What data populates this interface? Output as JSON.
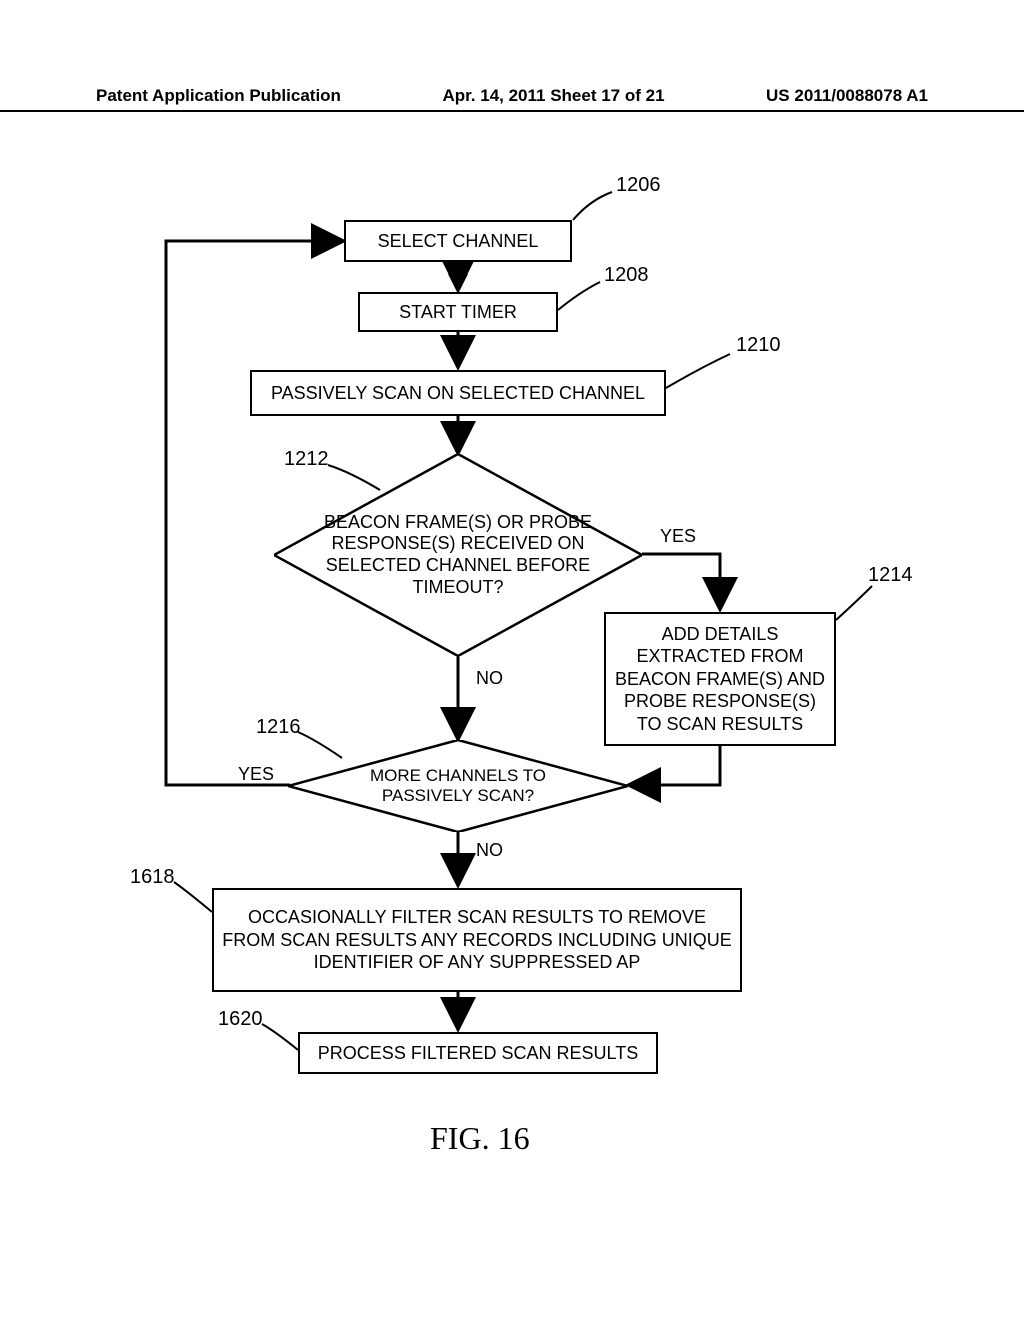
{
  "header": {
    "left": "Patent Application Publication",
    "center": "Apr. 14, 2011  Sheet 17 of 21",
    "right": "US 2011/0088078 A1"
  },
  "refs": {
    "r1206": "1206",
    "r1208": "1208",
    "r1210": "1210",
    "r1212": "1212",
    "r1214": "1214",
    "r1216": "1216",
    "r1618": "1618",
    "r1620": "1620"
  },
  "boxes": {
    "select_channel": "SELECT CHANNEL",
    "start_timer": "START TIMER",
    "passive_scan": "PASSIVELY SCAN ON SELECTED CHANNEL",
    "add_details": "ADD DETAILS EXTRACTED FROM BEACON FRAME(S) AND PROBE RESPONSE(S) TO SCAN RESULTS",
    "filter": "OCCASIONALLY FILTER SCAN RESULTS TO REMOVE FROM SCAN RESULTS ANY RECORDS INCLUDING UNIQUE IDENTIFIER OF ANY SUPPRESSED AP",
    "process": "PROCESS FILTERED SCAN RESULTS"
  },
  "diamonds": {
    "beacon": "BEACON FRAME(S) OR PROBE RESPONSE(S) RECEIVED ON SELECTED CHANNEL BEFORE TIMEOUT?",
    "more": "MORE CHANNELS TO PASSIVELY SCAN?"
  },
  "labels": {
    "yes": "YES",
    "no": "NO"
  },
  "caption": "FIG. 16"
}
